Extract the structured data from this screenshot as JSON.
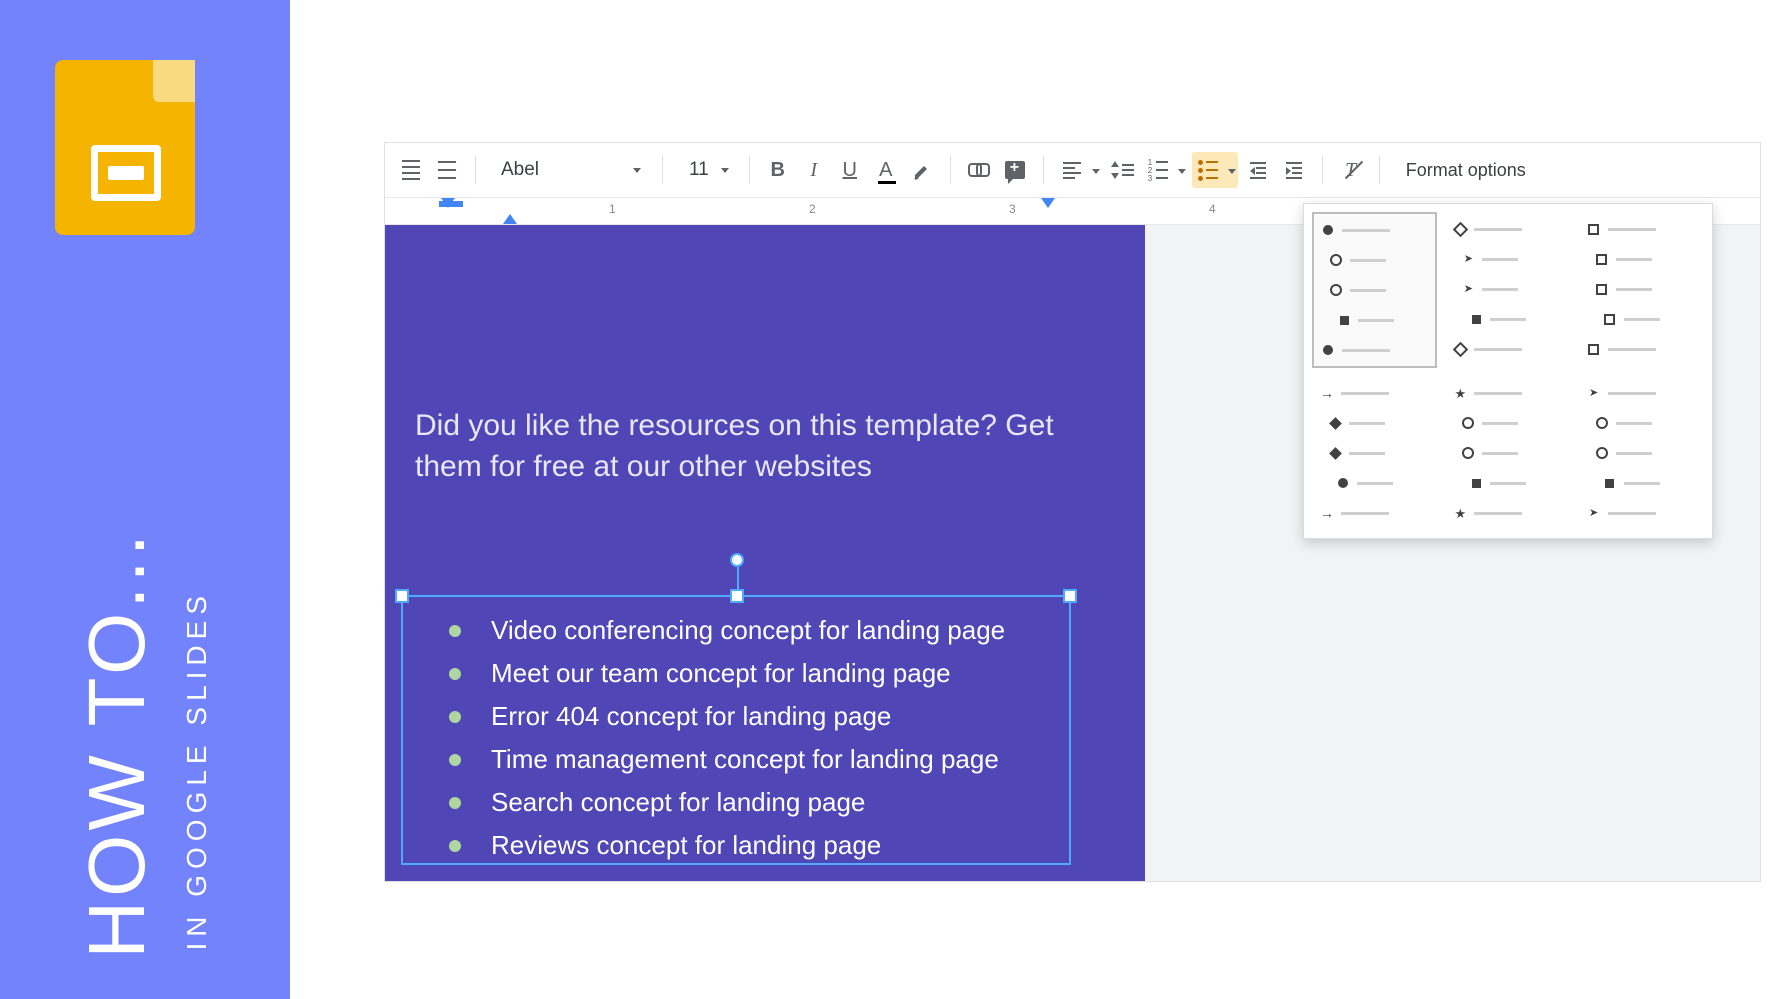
{
  "sidebar": {
    "title": "HOW TO...",
    "subtitle": "IN GOOGLE SLIDES"
  },
  "toolbar": {
    "font": "Abel",
    "size": "11",
    "bold": "B",
    "italic": "I",
    "underline": "U",
    "textcolor": "A",
    "format_options": "Format options"
  },
  "ruler": {
    "n1": "1",
    "n2": "2",
    "n3": "3",
    "n4": "4"
  },
  "slide": {
    "heading": "Did you like the resources on this template? Get them for free at our other websites",
    "items": [
      "Video conferencing concept for landing page",
      "Meet our team concept for landing page",
      "Error 404 concept for landing page",
      "Time management concept for landing page",
      "Search concept for landing page",
      "Reviews concept for landing page"
    ]
  }
}
